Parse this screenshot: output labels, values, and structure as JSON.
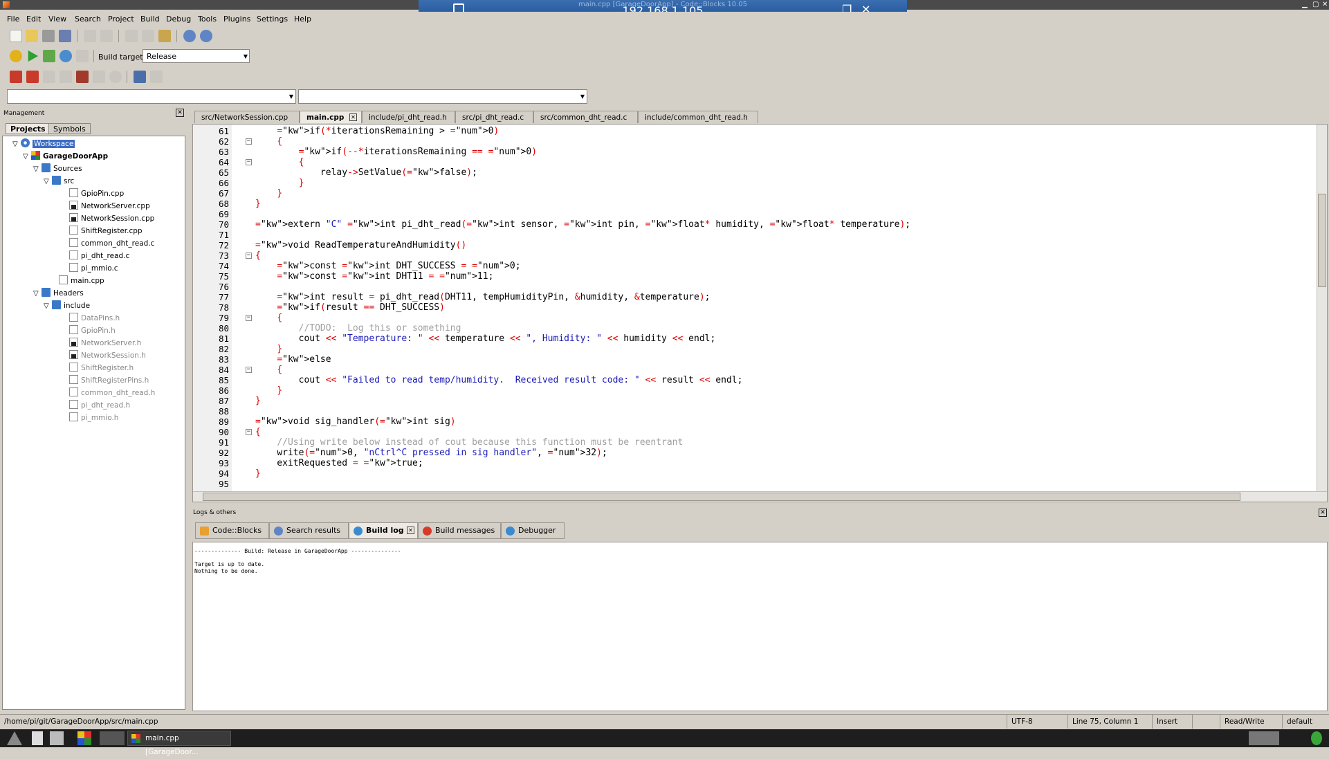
{
  "remote": {
    "ip": "192.168.1.105",
    "window_title": "main.cpp [GarageDoorApp] - Code::Blocks 10.05"
  },
  "menu": [
    "File",
    "Edit",
    "View",
    "Search",
    "Project",
    "Build",
    "Debug",
    "Tools",
    "Plugins",
    "Settings",
    "Help"
  ],
  "toolbar": {
    "build_target_label": "Build target:",
    "build_target_value": "Release"
  },
  "management": {
    "title": "Management",
    "tabs": [
      "Projects",
      "Symbols"
    ],
    "tree": [
      {
        "label": "Workspace",
        "icon": "workspace-icon"
      },
      {
        "label": "GarageDoorApp",
        "icon": "project-icon"
      },
      {
        "label": "Sources",
        "icon": "folder-icon"
      },
      {
        "label": "src",
        "icon": "folder-icon"
      },
      {
        "label": "GpioPin.cpp",
        "icon": "file-icon"
      },
      {
        "label": "NetworkServer.cpp",
        "icon": "locked-file-icon"
      },
      {
        "label": "NetworkSession.cpp",
        "icon": "locked-file-icon"
      },
      {
        "label": "ShiftRegister.cpp",
        "icon": "file-icon"
      },
      {
        "label": "common_dht_read.c",
        "icon": "file-icon"
      },
      {
        "label": "pi_dht_read.c",
        "icon": "file-icon"
      },
      {
        "label": "pi_mmio.c",
        "icon": "file-icon"
      },
      {
        "label": "main.cpp",
        "icon": "file-icon"
      },
      {
        "label": "Headers",
        "icon": "folder-icon"
      },
      {
        "label": "include",
        "icon": "folder-icon"
      },
      {
        "label": "DataPins.h",
        "icon": "file-icon"
      },
      {
        "label": "GpioPin.h",
        "icon": "file-icon"
      },
      {
        "label": "NetworkServer.h",
        "icon": "locked-file-icon"
      },
      {
        "label": "NetworkSession.h",
        "icon": "locked-file-icon"
      },
      {
        "label": "ShiftRegister.h",
        "icon": "file-icon"
      },
      {
        "label": "ShiftRegisterPins.h",
        "icon": "file-icon"
      },
      {
        "label": "common_dht_read.h",
        "icon": "file-icon"
      },
      {
        "label": "pi_dht_read.h",
        "icon": "file-icon"
      },
      {
        "label": "pi_mmio.h",
        "icon": "file-icon"
      }
    ]
  },
  "editor_tabs": [
    "src/NetworkSession.cpp",
    "main.cpp",
    "include/pi_dht_read.h",
    "src/pi_dht_read.c",
    "src/common_dht_read.c",
    "include/common_dht_read.h"
  ],
  "code": [
    {
      "n": "61",
      "t": "    if(*iterationsRemaining > 0)"
    },
    {
      "n": "62",
      "t": "    {"
    },
    {
      "n": "63",
      "t": "        if(--*iterationsRemaining == 0)"
    },
    {
      "n": "64",
      "t": "        {"
    },
    {
      "n": "65",
      "t": "            relay->SetValue(false);"
    },
    {
      "n": "66",
      "t": "        }"
    },
    {
      "n": "67",
      "t": "    }"
    },
    {
      "n": "68",
      "t": "}"
    },
    {
      "n": "69",
      "t": ""
    },
    {
      "n": "70",
      "t": "extern \"C\" int pi_dht_read(int sensor, int pin, float* humidity, float* temperature);"
    },
    {
      "n": "71",
      "t": ""
    },
    {
      "n": "72",
      "t": "void ReadTemperatureAndHumidity()"
    },
    {
      "n": "73",
      "t": "{"
    },
    {
      "n": "74",
      "t": "    const int DHT_SUCCESS = 0;"
    },
    {
      "n": "75",
      "t": "    const int DHT11 = 11;"
    },
    {
      "n": "76",
      "t": ""
    },
    {
      "n": "77",
      "t": "    int result = pi_dht_read(DHT11, tempHumidityPin, &humidity, &temperature);"
    },
    {
      "n": "78",
      "t": "    if(result == DHT_SUCCESS)"
    },
    {
      "n": "79",
      "t": "    {"
    },
    {
      "n": "80",
      "t": "        //TODO:  Log this or something"
    },
    {
      "n": "81",
      "t": "        cout << \"Temperature: \" << temperature << \", Humidity: \" << humidity << endl;"
    },
    {
      "n": "82",
      "t": "    }"
    },
    {
      "n": "83",
      "t": "    else"
    },
    {
      "n": "84",
      "t": "    {"
    },
    {
      "n": "85",
      "t": "        cout << \"Failed to read temp/humidity.  Received result code: \" << result << endl;"
    },
    {
      "n": "86",
      "t": "    }"
    },
    {
      "n": "87",
      "t": "}"
    },
    {
      "n": "88",
      "t": ""
    },
    {
      "n": "89",
      "t": "void sig_handler(int sig)"
    },
    {
      "n": "90",
      "t": "{"
    },
    {
      "n": "91",
      "t": "    //Using write below instead of cout because this function must be reentrant"
    },
    {
      "n": "92",
      "t": "    write(0, \"nCtrl^C pressed in sig handler\", 32);"
    },
    {
      "n": "93",
      "t": "    exitRequested = true;"
    },
    {
      "n": "94",
      "t": "}"
    },
    {
      "n": "95",
      "t": ""
    }
  ],
  "logs": {
    "title": "Logs & others",
    "tabs": [
      "Code::Blocks",
      "Search results",
      "Build log",
      "Build messages",
      "Debugger"
    ],
    "build_log": "-------------- Build: Release in GarageDoorApp ---------------\n\nTarget is up to date.\nNothing to be done."
  },
  "status": {
    "path": "/home/pi/git/GarageDoorApp/src/main.cpp",
    "encoding": "UTF-8",
    "position": "Line 75, Column 1",
    "mode": "Insert",
    "access": "Read/Write",
    "profile": "default"
  },
  "taskbar": {
    "task_label": "main.cpp [GarageDoor..."
  }
}
